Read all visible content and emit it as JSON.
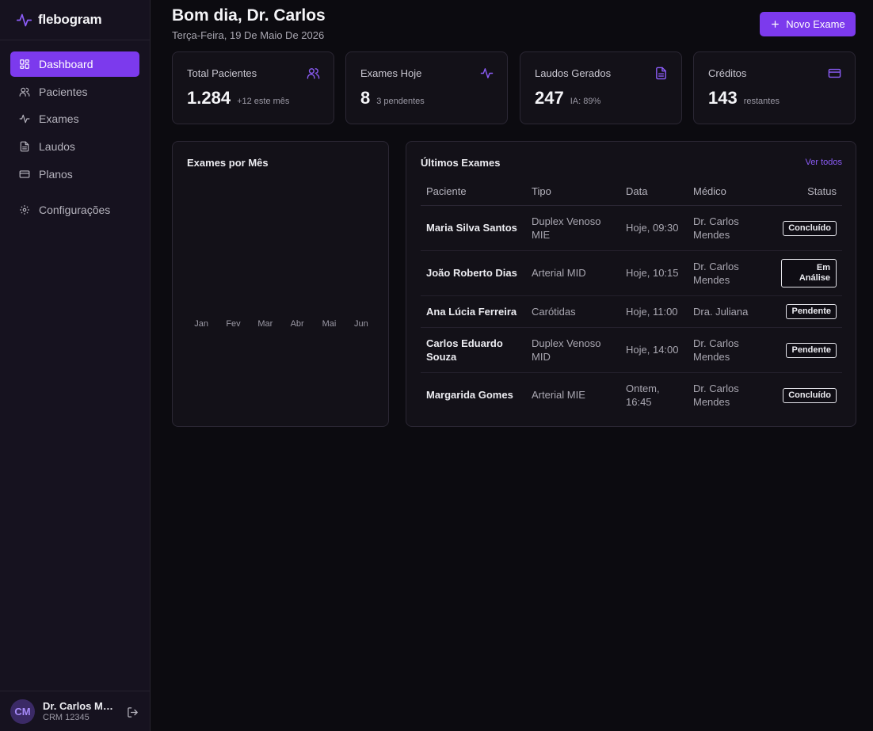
{
  "app": {
    "name": "flebogram"
  },
  "sidebar": {
    "items": [
      {
        "label": "Dashboard",
        "icon": "dashboard-icon"
      },
      {
        "label": "Pacientes",
        "icon": "users-icon"
      },
      {
        "label": "Exames",
        "icon": "activity-icon"
      },
      {
        "label": "Laudos",
        "icon": "file-icon"
      },
      {
        "label": "Planos",
        "icon": "credit-card-icon"
      }
    ],
    "settings": {
      "label": "Configurações",
      "icon": "gear-icon"
    },
    "user": {
      "initials": "CM",
      "name": "Dr. Carlos Mendes",
      "crm": "CRM 12345"
    }
  },
  "header": {
    "title": "Bom dia, Dr. Carlos",
    "date": "Terça-Feira, 19 De Maio De 2026",
    "new_button": "Novo Exame"
  },
  "stats": [
    {
      "title": "Total Pacientes",
      "value": "1.284",
      "sub": "+12 este mês",
      "icon": "users-icon"
    },
    {
      "title": "Exames Hoje",
      "value": "8",
      "sub": "3 pendentes",
      "icon": "activity-icon"
    },
    {
      "title": "Laudos Gerados",
      "value": "247",
      "sub": "IA: 89%",
      "icon": "file-icon"
    },
    {
      "title": "Créditos",
      "value": "143",
      "sub": "restantes",
      "icon": "credit-card-icon"
    }
  ],
  "chart_panel": {
    "title": "Exames por Mês"
  },
  "chart_data": {
    "type": "bar",
    "categories": [
      "Jan",
      "Fev",
      "Mar",
      "Abr",
      "Mai",
      "Jun"
    ],
    "values": [
      0,
      0,
      0,
      0,
      0,
      0
    ],
    "title": "Exames por Mês",
    "xlabel": "",
    "ylabel": ""
  },
  "recent": {
    "title": "Últimos Exames",
    "see_all": "Ver todos",
    "columns": [
      "Paciente",
      "Tipo",
      "Data",
      "Médico",
      "Status"
    ],
    "rows": [
      {
        "patient": "Maria Silva Santos",
        "type": "Duplex Venoso MIE",
        "date": "Hoje, 09:30",
        "doctor": "Dr. Carlos Mendes",
        "status": "Concluído"
      },
      {
        "patient": "João Roberto Dias",
        "type": "Arterial MID",
        "date": "Hoje, 10:15",
        "doctor": "Dr. Carlos Mendes",
        "status": "Em Análise"
      },
      {
        "patient": "Ana Lúcia Ferreira",
        "type": "Carótidas",
        "date": "Hoje, 11:00",
        "doctor": "Dra. Juliana",
        "status": "Pendente"
      },
      {
        "patient": "Carlos Eduardo Souza",
        "type": "Duplex Venoso MID",
        "date": "Hoje, 14:00",
        "doctor": "Dr. Carlos Mendes",
        "status": "Pendente"
      },
      {
        "patient": "Margarida Gomes",
        "type": "Arterial MIE",
        "date": "Ontem, 16:45",
        "doctor": "Dr. Carlos Mendes",
        "status": "Concluído"
      }
    ]
  },
  "colors": {
    "accent": "#7c3aed",
    "accent_text": "#8b5cf6",
    "background": "#0c0b10",
    "sidebar": "#16121f",
    "card": "#131118"
  }
}
